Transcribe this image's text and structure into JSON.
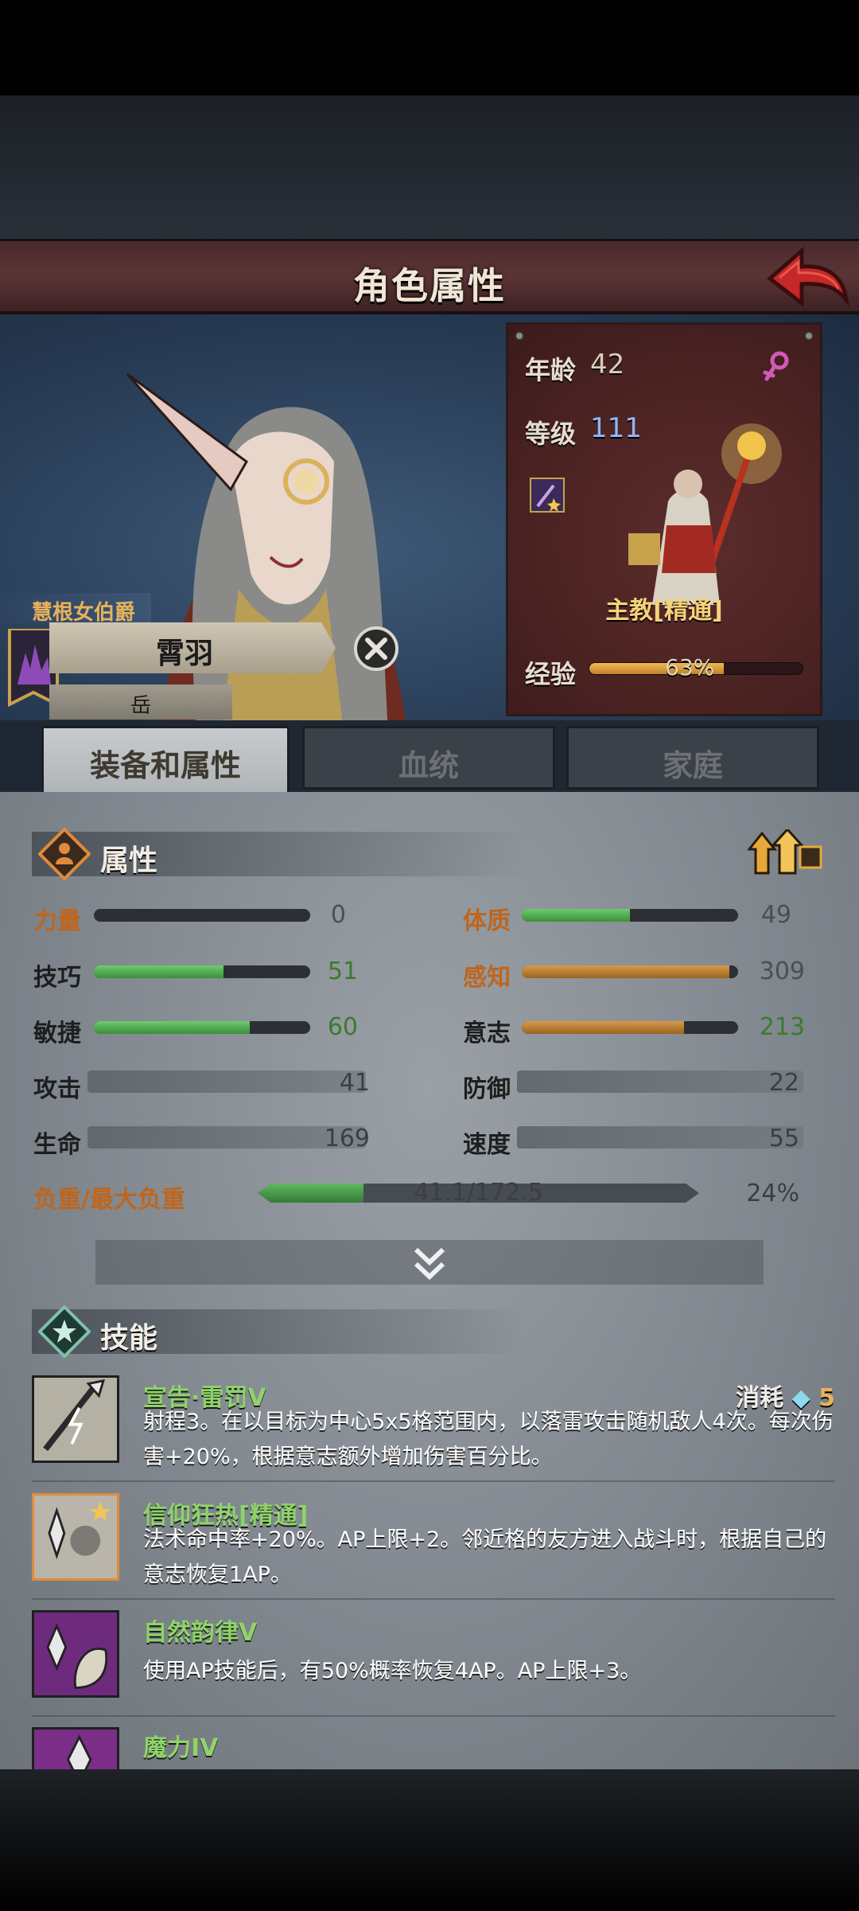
{
  "header": {
    "title": "角色属性"
  },
  "character": {
    "title": "慧根女伯爵",
    "name": "霄羽",
    "family": "岳",
    "age_label": "年龄",
    "age": "42",
    "level_label": "等级",
    "level": "111",
    "class_name": "主教[精通]",
    "exp_label": "经验",
    "exp_percent_text": "63%",
    "exp_fraction": 0.63
  },
  "tabs": [
    {
      "label": "装备和属性",
      "active": true
    },
    {
      "label": "血统",
      "active": false
    },
    {
      "label": "家庭",
      "active": false
    }
  ],
  "attributes": {
    "section_title": "属性",
    "strength": {
      "label": "力量",
      "value": "0",
      "fraction": 0.0
    },
    "skill": {
      "label": "技巧",
      "value": "51",
      "fraction": 0.6
    },
    "agility": {
      "label": "敏捷",
      "value": "60",
      "fraction": 0.72
    },
    "constitution": {
      "label": "体质",
      "value": "49",
      "fraction": 0.5
    },
    "perception": {
      "label": "感知",
      "value": "309",
      "fraction": 0.96
    },
    "will": {
      "label": "意志",
      "value": "213",
      "fraction": 0.75
    },
    "attack": {
      "label": "攻击",
      "value": "41"
    },
    "defense": {
      "label": "防御",
      "value": "22"
    },
    "life": {
      "label": "生命",
      "value": "169"
    },
    "speed": {
      "label": "速度",
      "value": "55"
    },
    "load": {
      "label": "负重/最大负重",
      "value": "41.1/172.5",
      "percent": "24%",
      "fraction": 0.24
    }
  },
  "skills": {
    "section_title": "技能",
    "cost_label": "消耗",
    "items": [
      {
        "name": "宣告·雷罚V",
        "cost": "5",
        "desc": "射程3。在以目标为中心5x5格范围内，以落雷攻击随机敌人4次。每次伤害+20%，根据意志额外增加伤害百分比。"
      },
      {
        "name": "信仰狂热[精通]",
        "desc": "法术命中率+20%。AP上限+2。邻近格的友方进入战斗时，根据自己的意志恢复1AP。"
      },
      {
        "name": "自然韵律V",
        "desc": "使用AP技能后，有50%概率恢复4AP。AP上限+3。"
      },
      {
        "name": "魔力IV",
        "desc": ""
      }
    ]
  },
  "colors": {
    "accent_gold": "#e8b25a",
    "skill_green": "#8fd36a",
    "stat_orange": "#c0651c",
    "stat_green": "#3c7a2c",
    "level_blue": "#8fb6ff"
  }
}
